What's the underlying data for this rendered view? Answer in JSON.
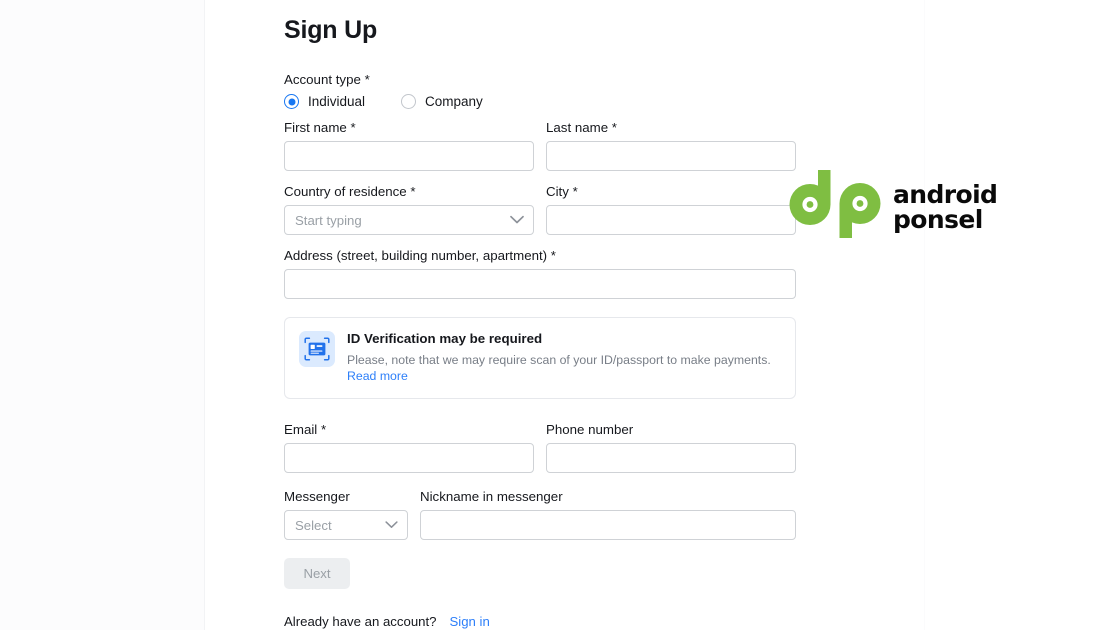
{
  "page": {
    "title": "Sign Up"
  },
  "account_type": {
    "label": "Account type *",
    "options": [
      {
        "label": "Individual",
        "selected": true
      },
      {
        "label": "Company",
        "selected": false
      }
    ]
  },
  "fields": {
    "first_name": {
      "label": "First name *",
      "value": "",
      "placeholder": ""
    },
    "last_name": {
      "label": "Last name *",
      "value": "",
      "placeholder": ""
    },
    "country": {
      "label": "Country of residence *",
      "value": "",
      "placeholder": "Start typing"
    },
    "city": {
      "label": "City *",
      "value": "",
      "placeholder": ""
    },
    "address": {
      "label": "Address (street, building number, apartment) *",
      "value": "",
      "placeholder": ""
    },
    "email": {
      "label": "Email *",
      "value": "",
      "placeholder": ""
    },
    "phone": {
      "label": "Phone number",
      "value": "",
      "placeholder": ""
    },
    "messenger": {
      "label": "Messenger",
      "value": "Select",
      "placeholder": "Select"
    },
    "nickname": {
      "label": "Nickname in messenger",
      "value": "",
      "placeholder": ""
    }
  },
  "notice": {
    "icon": "id-card-scan-icon",
    "title": "ID Verification may be required",
    "text": "Please, note that we may require scan of your ID/passport to make payments.",
    "link_label": "Read more"
  },
  "actions": {
    "next_label": "Next",
    "next_disabled": true,
    "have_account_text": "Already have an account?",
    "sign_in_label": "Sign in"
  },
  "watermark": {
    "mark": "dp-logo-icon",
    "line1": "android",
    "line2": "ponsel"
  },
  "colors": {
    "accent_blue": "#1877f2",
    "link_blue": "#2d7ff9",
    "text": "#16181d",
    "muted_text": "#787e87",
    "placeholder": "#9aa0a6",
    "border": "#cfd2d6",
    "notice_icon_bg": "#dbeafe",
    "notice_icon_blue": "#2272eb",
    "button_disabled_bg": "#eceef0",
    "logo_green": "#7fbe42",
    "logo_black": "#0a0a0a"
  }
}
